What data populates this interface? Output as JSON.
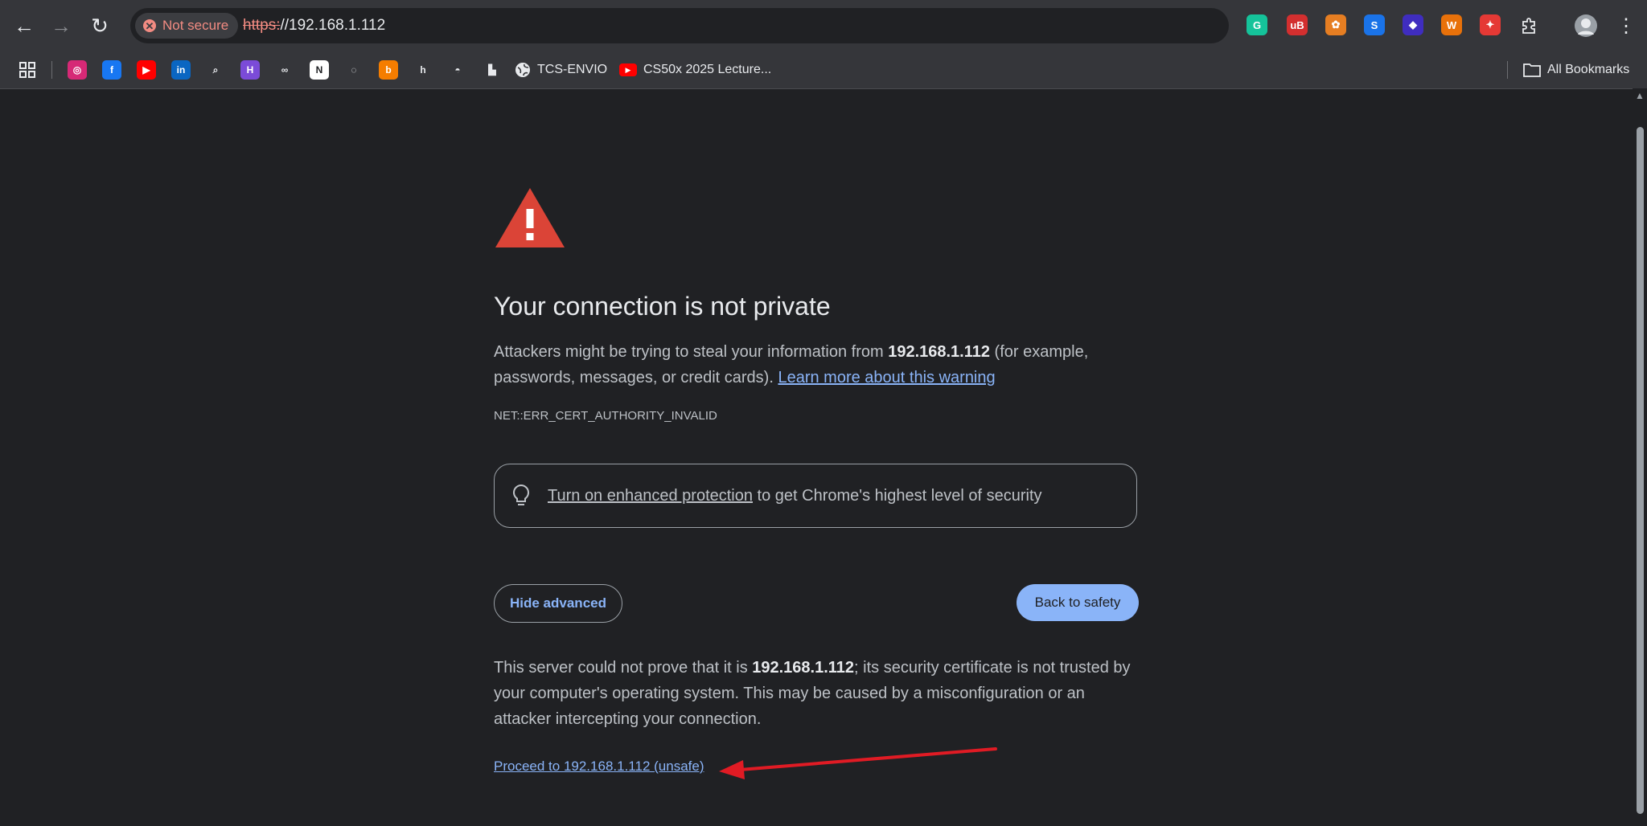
{
  "browser": {
    "chip_label": "Not secure",
    "url_scheme": "https:",
    "url_rest": "//192.168.1.112",
    "extensions": [
      {
        "name": "grammarly",
        "glyph": "G",
        "color": "#15c39a"
      },
      {
        "name": "ublock",
        "glyph": "uB",
        "color": "#d32f2f"
      },
      {
        "name": "cookie",
        "glyph": "✿",
        "color": "#e67e22"
      },
      {
        "name": "s-ext",
        "glyph": "S",
        "color": "#1a73e8"
      },
      {
        "name": "diamond",
        "glyph": "◆",
        "color": "#3f2dbf"
      },
      {
        "name": "wappalyzer",
        "glyph": "W",
        "color": "#e8710a"
      },
      {
        "name": "pin-ext",
        "glyph": "✦",
        "color": "#e53935"
      }
    ]
  },
  "bookmarks": {
    "items": [
      {
        "name": "instagram",
        "glyph": "◎",
        "color": "#d62976"
      },
      {
        "name": "facebook",
        "glyph": "f",
        "color": "#1877f2"
      },
      {
        "name": "youtube",
        "glyph": "▶",
        "color": "#ff0000"
      },
      {
        "name": "linkedin",
        "glyph": "in",
        "color": "#0a66c2"
      },
      {
        "name": "search",
        "glyph": "⌕",
        "color": "#35363a"
      },
      {
        "name": "h-app",
        "glyph": "H",
        "color": "#7b4bd8"
      },
      {
        "name": "meta",
        "glyph": "∞",
        "color": "#35363a"
      },
      {
        "name": "notion",
        "glyph": "N",
        "color": "#ffffff"
      },
      {
        "name": "red-ext",
        "glyph": "◌",
        "color": "#35363a"
      },
      {
        "name": "blogger",
        "glyph": "b",
        "color": "#f57d00"
      },
      {
        "name": "h-letter",
        "glyph": "h",
        "color": "#35363a"
      },
      {
        "name": "discord",
        "glyph": "◓",
        "color": "#35363a"
      },
      {
        "name": "hat",
        "glyph": "▙",
        "color": "#35363a"
      }
    ],
    "tcs_label": "TCS-ENVIO",
    "cs50_label": "CS50x 2025 Lecture...",
    "all_bookmarks_label": "All Bookmarks"
  },
  "page": {
    "heading": "Your connection is not private",
    "msg_prefix": "Attackers might be trying to steal your information from ",
    "msg_host": "192.168.1.112",
    "msg_suffix": " (for example, passwords, messages, or credit cards). ",
    "learn_more": "Learn more about this warning",
    "error_code": "NET::ERR_CERT_AUTHORITY_INVALID",
    "ep_link": "Turn on enhanced protection",
    "ep_rest": " to get Chrome's highest level of security",
    "hide_advanced": "Hide advanced",
    "back_to_safety": "Back to safety",
    "details_prefix": "This server could not prove that it is ",
    "details_host": "192.168.1.112",
    "details_suffix": "; its security certificate is not trusted by your computer's operating system. This may be caused by a misconfiguration or an attacker intercepting your connection.",
    "proceed": "Proceed to 192.168.1.112 (unsafe)"
  },
  "colors": {
    "background": "#202124",
    "link": "#8ab4f8",
    "warning": "#db4437",
    "annotation_arrow": "#e01b24"
  }
}
